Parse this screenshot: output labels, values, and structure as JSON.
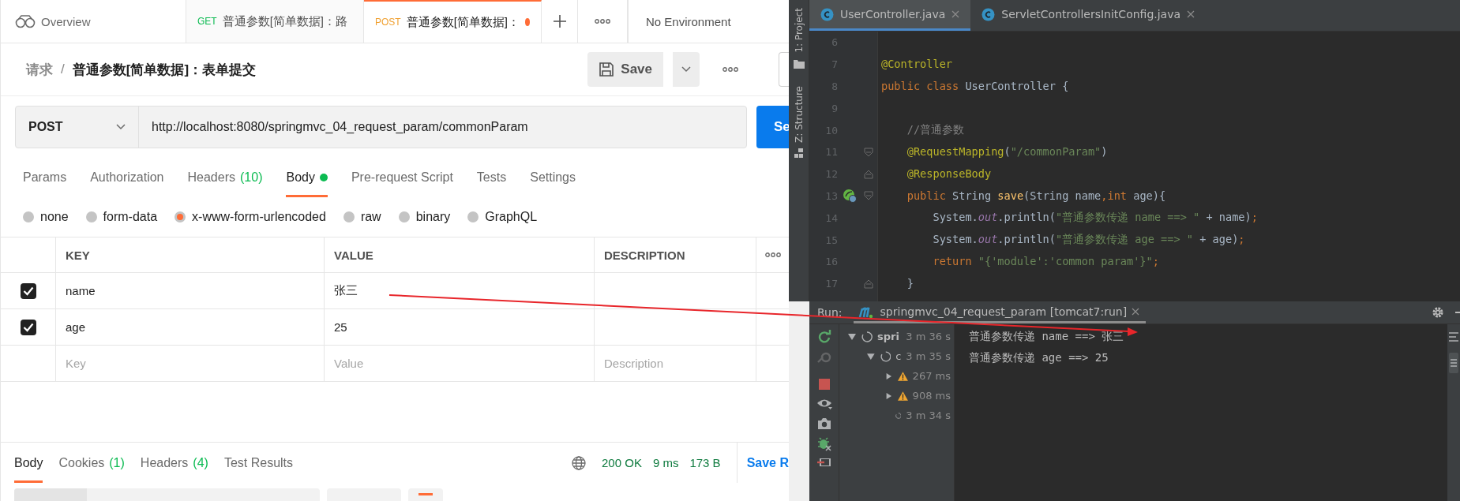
{
  "postman": {
    "tabs": [
      {
        "kind": "overview",
        "label": "Overview",
        "selected": false
      },
      {
        "kind": "request",
        "method": "GET",
        "label": "普通参数[简单数据]：路",
        "selected": false,
        "unsaved": false
      },
      {
        "kind": "request",
        "method": "POST",
        "label": "普通参数[简单数据]：",
        "selected": true,
        "unsaved": true
      }
    ],
    "environment": "No Environment",
    "breadcrumb": {
      "parent": "请求",
      "separator": "/",
      "title": "普通参数[简单数据]：表单提交"
    },
    "save_label": "Save",
    "method": "POST",
    "url": "http://localhost:8080/springmvc_04_request_param/commonParam",
    "send_label": "Se",
    "request_tabs": [
      {
        "label": "Params",
        "selected": false
      },
      {
        "label": "Authorization",
        "selected": false
      },
      {
        "label": "Headers",
        "count": "(10)",
        "selected": false
      },
      {
        "label": "Body",
        "selected": true,
        "has_content": true
      },
      {
        "label": "Pre-request Script",
        "selected": false
      },
      {
        "label": "Tests",
        "selected": false
      },
      {
        "label": "Settings",
        "selected": false
      }
    ],
    "body_types": [
      {
        "label": "none",
        "selected": false
      },
      {
        "label": "form-data",
        "selected": false
      },
      {
        "label": "x-www-form-urlencoded",
        "selected": true
      },
      {
        "label": "raw",
        "selected": false
      },
      {
        "label": "binary",
        "selected": false
      },
      {
        "label": "GraphQL",
        "selected": false
      }
    ],
    "params": {
      "columns": [
        "KEY",
        "VALUE",
        "DESCRIPTION"
      ],
      "rows": [
        {
          "checked": true,
          "key": "name",
          "value": "张三"
        },
        {
          "checked": true,
          "key": "age",
          "value": "25"
        }
      ],
      "new_row": {
        "key": {
          "placeholder": "Key"
        },
        "value": {
          "placeholder": "Value"
        },
        "description": {
          "placeholder": "Description"
        }
      }
    },
    "response": {
      "tabs": [
        {
          "label": "Body",
          "selected": true
        },
        {
          "label": "Cookies",
          "count": "(1)",
          "selected": false
        },
        {
          "label": "Headers",
          "count": "(4)",
          "selected": false
        },
        {
          "label": "Test Results",
          "selected": false
        }
      ],
      "status": "200 OK",
      "time": "9 ms",
      "size": "173 B",
      "save_label": "Save R"
    }
  },
  "ide": {
    "side_tools": [
      "1: Project",
      "Z: Structure"
    ],
    "editor_tabs": [
      {
        "label": "UserController.java",
        "selected": true
      },
      {
        "label": "ServletControllersInitConfig.java",
        "selected": false
      }
    ],
    "code": [
      {
        "number": "6",
        "fold_start": false,
        "fold_end": false,
        "bean": false
      },
      {
        "number": "7",
        "fold_start": false,
        "fold_end": false,
        "bean": false,
        "tokens": [
          {
            "kind": "annotation",
            "text": "@Controller"
          }
        ]
      },
      {
        "number": "8",
        "fold_start": false,
        "fold_end": false,
        "bean": false,
        "tokens": [
          {
            "kind": "keyword",
            "text": "public class "
          },
          {
            "kind": "plain",
            "text": "UserController {"
          }
        ]
      },
      {
        "number": "9",
        "fold_start": false,
        "fold_end": false,
        "bean": false
      },
      {
        "number": "10",
        "fold_start": false,
        "fold_end": false,
        "bean": false,
        "tokens": [
          {
            "kind": "comment",
            "text": "    //普通参数"
          }
        ]
      },
      {
        "number": "11",
        "fold_start": true,
        "fold_end": false,
        "bean": false,
        "tokens": [
          {
            "kind": "annotation",
            "text": "    @RequestMapping"
          },
          {
            "kind": "plain",
            "text": "("
          },
          {
            "kind": "string",
            "text": "\"/commonParam\""
          },
          {
            "kind": "plain",
            "text": ")"
          }
        ]
      },
      {
        "number": "12",
        "fold_start": false,
        "fold_end": true,
        "bean": false,
        "tokens": [
          {
            "kind": "annotation",
            "text": "    @ResponseBody"
          }
        ]
      },
      {
        "number": "13",
        "fold_start": true,
        "fold_end": false,
        "bean": true,
        "tokens": [
          {
            "kind": "keyword",
            "text": "    public "
          },
          {
            "kind": "plain",
            "text": "String "
          },
          {
            "kind": "method",
            "text": "save"
          },
          {
            "kind": "plain",
            "text": "(String name"
          },
          {
            "kind": "keyword",
            "text": ","
          },
          {
            "kind": "keyword",
            "text": "int "
          },
          {
            "kind": "plain",
            "text": "age){"
          }
        ]
      },
      {
        "number": "14",
        "fold_start": false,
        "fold_end": false,
        "bean": false,
        "tokens": [
          {
            "kind": "plain",
            "text": "        System."
          },
          {
            "kind": "static",
            "text": "out"
          },
          {
            "kind": "plain",
            "text": ".println("
          },
          {
            "kind": "string",
            "text": "\"普通参数传递 name ==> \""
          },
          {
            "kind": "plain",
            "text": " + name)"
          },
          {
            "kind": "keyword",
            "text": ";"
          }
        ]
      },
      {
        "number": "15",
        "fold_start": false,
        "fold_end": false,
        "bean": false,
        "tokens": [
          {
            "kind": "plain",
            "text": "        System."
          },
          {
            "kind": "static",
            "text": "out"
          },
          {
            "kind": "plain",
            "text": ".println("
          },
          {
            "kind": "string",
            "text": "\"普通参数传递 age ==> \""
          },
          {
            "kind": "plain",
            "text": " + age)"
          },
          {
            "kind": "keyword",
            "text": ";"
          }
        ]
      },
      {
        "number": "16",
        "fold_start": false,
        "fold_end": false,
        "bean": false,
        "tokens": [
          {
            "kind": "keyword",
            "text": "        return "
          },
          {
            "kind": "string",
            "text": "\"{'module':'common param'}\""
          },
          {
            "kind": "keyword",
            "text": ";"
          }
        ]
      },
      {
        "number": "17",
        "fold_start": false,
        "fold_end": true,
        "bean": false,
        "tokens": [
          {
            "kind": "plain",
            "text": "    }"
          }
        ]
      }
    ],
    "run": {
      "label": "Run:",
      "config": "springmvc_04_request_param [tomcat7:run]",
      "tree": [
        {
          "kind": "running",
          "label": "spri",
          "time": "3 m 36 s",
          "has_children": true,
          "expanded": true,
          "children": [
            {
              "kind": "running",
              "label": "c",
              "time": "3 m 35 s",
              "has_children": true,
              "expanded": true,
              "children": [
                {
                  "kind": "warning",
                  "time": "267 ms",
                  "has_children": true,
                  "expanded": false
                },
                {
                  "kind": "warning",
                  "time": "908 ms",
                  "has_children": true,
                  "expanded": false
                },
                {
                  "kind": "running",
                  "time": "3 m 34 s",
                  "has_children": false
                }
              ]
            }
          ]
        }
      ],
      "console": [
        "普通参数传递 name ==> 张三",
        "普通参数传递 age ==> 25"
      ]
    }
  }
}
